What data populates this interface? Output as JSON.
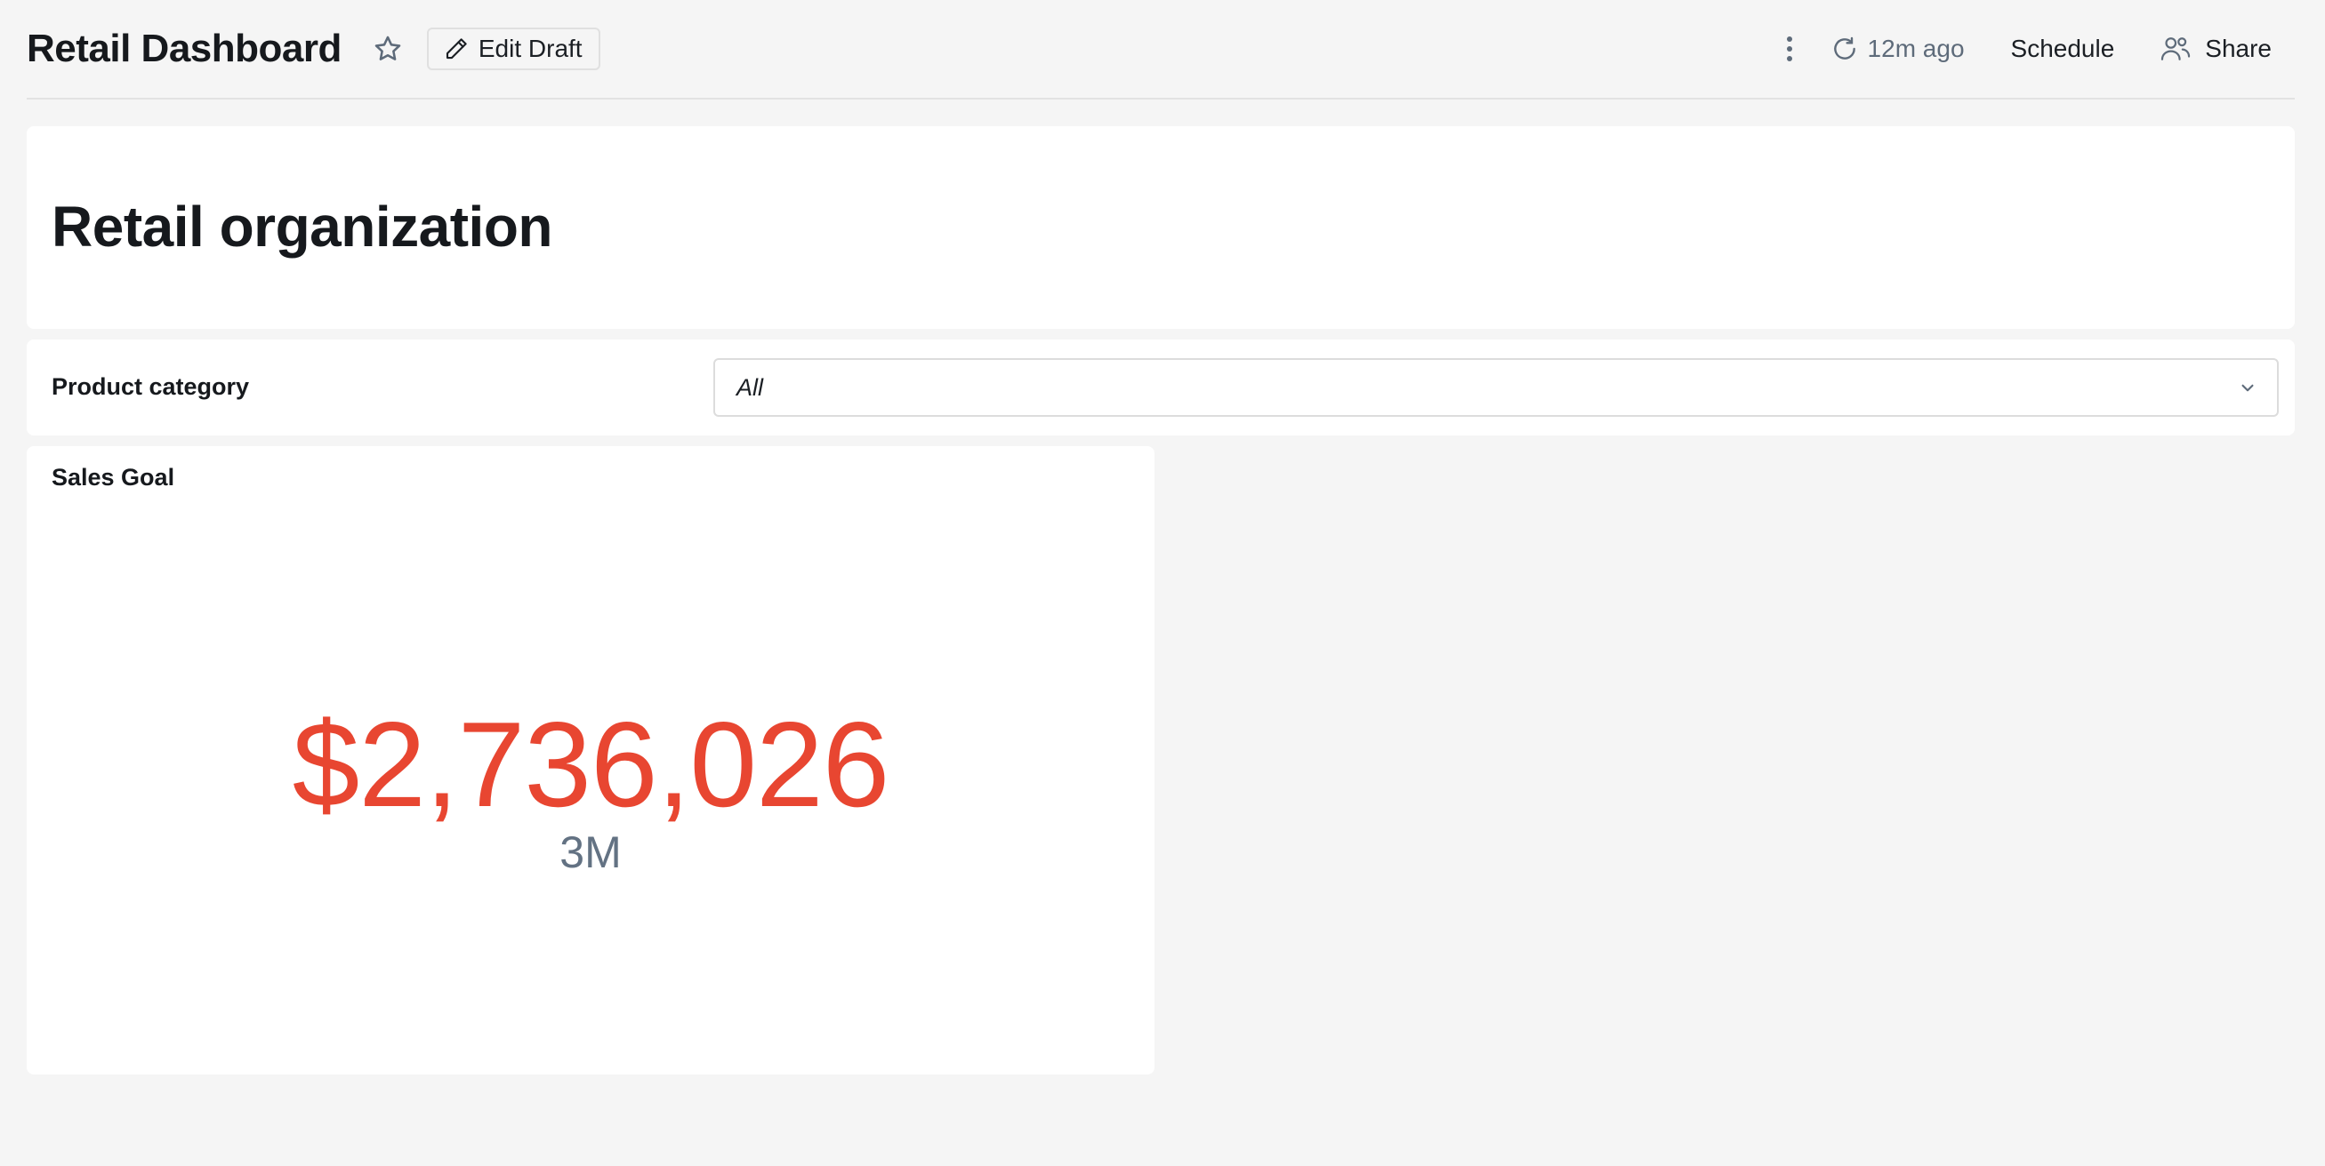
{
  "header": {
    "title": "Retail Dashboard",
    "edit_draft_label": "Edit Draft",
    "refresh_label": "12m ago",
    "schedule_label": "Schedule",
    "share_label": "Share"
  },
  "sections": {
    "org_title": "Retail organization"
  },
  "filter": {
    "label": "Product category",
    "selected": "All"
  },
  "kpi": {
    "title": "Sales Goal",
    "value": "$2,736,026",
    "target": "3M",
    "value_color": "#e84631"
  },
  "icons": [
    "star-icon",
    "pencil-icon",
    "more-vertical-icon",
    "refresh-icon",
    "users-icon",
    "chevron-down-icon"
  ]
}
